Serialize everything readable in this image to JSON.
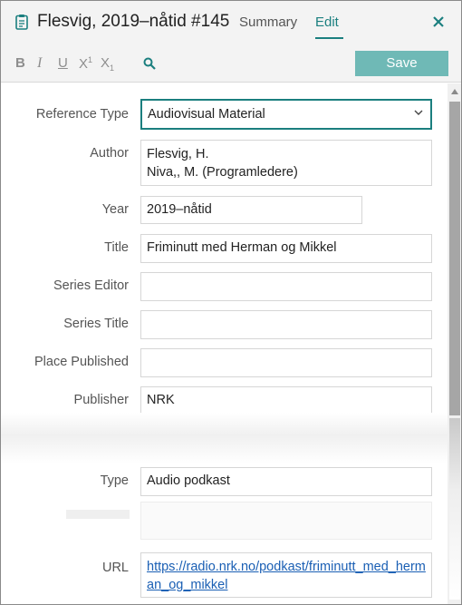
{
  "header": {
    "title": "Flesvig, 2019–nåtid #145",
    "tabs": [
      {
        "label": "Summary",
        "active": false
      },
      {
        "label": "Edit",
        "active": true
      }
    ],
    "accent_color": "#1b7f7f"
  },
  "toolbar": {
    "bold": "B",
    "italic": "I",
    "underline": "U",
    "superscript": "X",
    "superscript_mark": "1",
    "subscript": "X",
    "subscript_mark": "1",
    "search_icon": "search-icon",
    "save_label": "Save",
    "save_color": "#6fb9b6"
  },
  "form": {
    "reference_type": {
      "label": "Reference Type",
      "value": "Audiovisual Material"
    },
    "author": {
      "label": "Author",
      "line1": "Flesvig, H.",
      "line2": "Niva,, M. (Programledere)"
    },
    "year": {
      "label": "Year",
      "value": "2019–nåtid"
    },
    "title": {
      "label": "Title",
      "value": "Friminutt med Herman og Mikkel"
    },
    "series_editor": {
      "label": "Series Editor",
      "value": ""
    },
    "series_title": {
      "label": "Series Title",
      "value": ""
    },
    "place_published": {
      "label": "Place Published",
      "value": ""
    },
    "publisher": {
      "label": "Publisher",
      "value": "NRK"
    },
    "type": {
      "label": "Type",
      "value": "Audio podkast"
    },
    "url": {
      "label": "URL",
      "value": "https://radio.nrk.no/podkast/friminutt_med_herman_og_mikkel"
    }
  }
}
